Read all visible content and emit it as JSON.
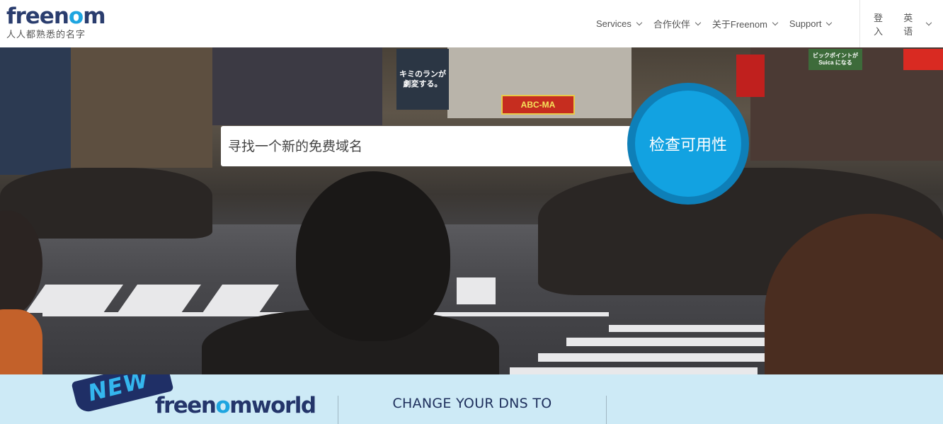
{
  "header": {
    "logo": {
      "part1": "free",
      "part2": "n",
      "part3": "o",
      "part4": "m",
      "tagline": "人人都熟悉的名字"
    },
    "nav": [
      {
        "label": "Services",
        "has_dropdown": true
      },
      {
        "label": "合作伙伴",
        "has_dropdown": true
      },
      {
        "label": "关于Freenom",
        "has_dropdown": true
      },
      {
        "label": "Support",
        "has_dropdown": true
      }
    ],
    "right_nav": [
      {
        "label": "登入",
        "has_dropdown": false
      },
      {
        "label": "英语",
        "has_dropdown": true
      }
    ]
  },
  "hero": {
    "search_placeholder": "寻找一个新的免费域名",
    "search_value": "",
    "check_button": "检查可用性",
    "signs": [
      "ABC-MA",
      "キミのランが 劇変する。",
      "ビックポイントが Suica になる"
    ]
  },
  "banner": {
    "badge": "NEW",
    "logo_dark": "freen",
    "logo_blue": "o",
    "logo_dark2": "m",
    "logo_world": "world",
    "dns_heading": "CHANGE YOUR DNS TO"
  },
  "colors": {
    "brand_dark": "#2a3d6e",
    "brand_blue": "#1ea5e0",
    "button_blue": "#12a2e1",
    "banner_bg": "#cdeaf6"
  }
}
